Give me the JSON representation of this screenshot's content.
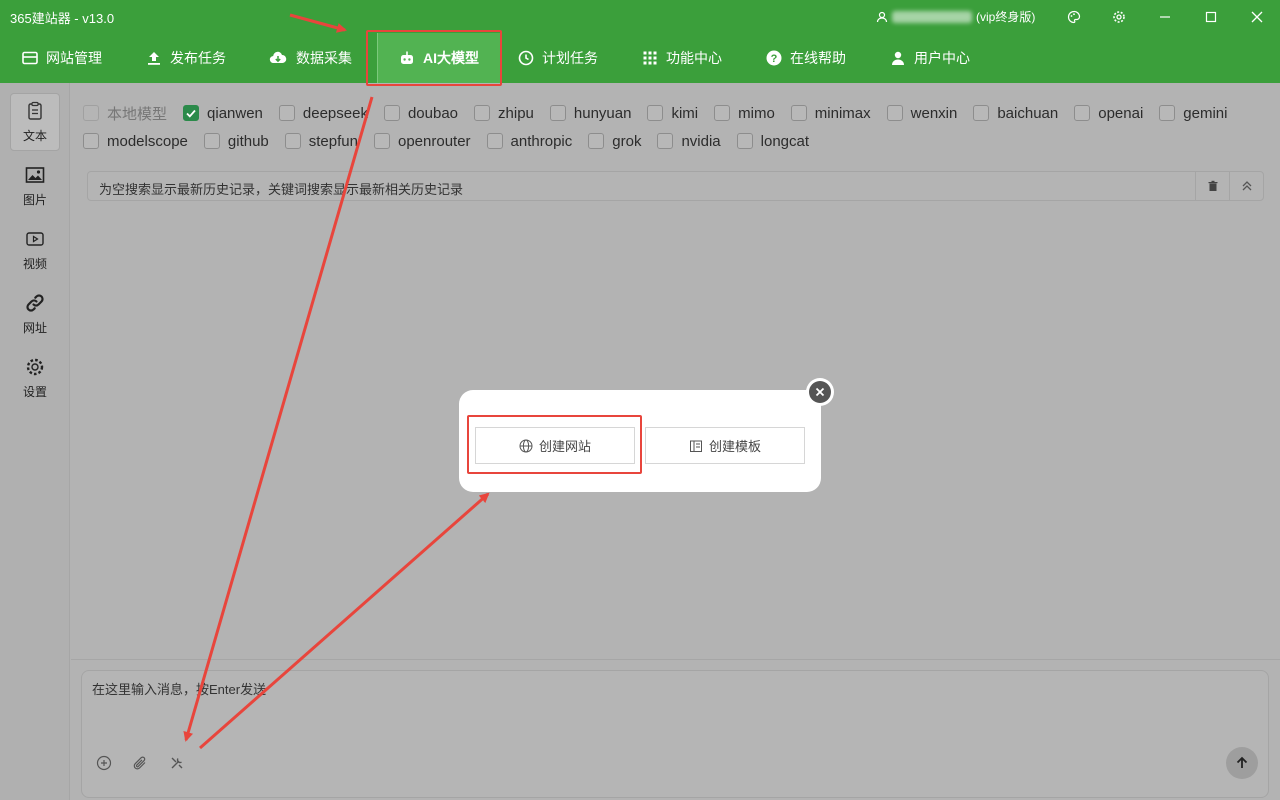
{
  "window": {
    "title": "365建站器 - v13.0",
    "user_label": "(vip终身版)"
  },
  "nav": {
    "items": [
      {
        "label": "网站管理",
        "icon": "website-icon"
      },
      {
        "label": "发布任务",
        "icon": "upload-icon"
      },
      {
        "label": "数据采集",
        "icon": "cloud-download-icon"
      },
      {
        "label": "AI大模型",
        "icon": "robot-icon",
        "active": true
      },
      {
        "label": "计划任务",
        "icon": "clock-icon"
      },
      {
        "label": "功能中心",
        "icon": "grid-icon"
      },
      {
        "label": "在线帮助",
        "icon": "help-icon"
      },
      {
        "label": "用户中心",
        "icon": "user-icon"
      }
    ]
  },
  "sidebar": {
    "items": [
      {
        "label": "文本",
        "icon": "document-icon",
        "active": true
      },
      {
        "label": "图片",
        "icon": "image-icon"
      },
      {
        "label": "视频",
        "icon": "video-icon"
      },
      {
        "label": "网址",
        "icon": "link-icon"
      },
      {
        "label": "设置",
        "icon": "settings-icon"
      }
    ]
  },
  "models": {
    "row1": [
      "本地模型",
      "qianwen",
      "deepseek",
      "doubao",
      "zhipu",
      "hunyuan",
      "kimi",
      "mimo",
      "minimax",
      "wenxin",
      "baichuan",
      "openai",
      "gemini"
    ],
    "row2": [
      "modelscope",
      "github",
      "stepfun",
      "openrouter",
      "anthropic",
      "grok",
      "nvidia",
      "longcat"
    ],
    "checked": "qianwen",
    "disabled": "本地模型"
  },
  "history": {
    "placeholder": "为空搜索显示最新历史记录，关键词搜索显示最新相关历史记录"
  },
  "composer": {
    "placeholder": "在这里输入消息，按Enter发送"
  },
  "modal": {
    "create_site_label": "创建网站",
    "create_template_label": "创建模板"
  },
  "colors": {
    "brand_green": "#3b9f3b",
    "annotation_red": "#e8453c",
    "checkbox_checked": "#2b8a4a"
  }
}
